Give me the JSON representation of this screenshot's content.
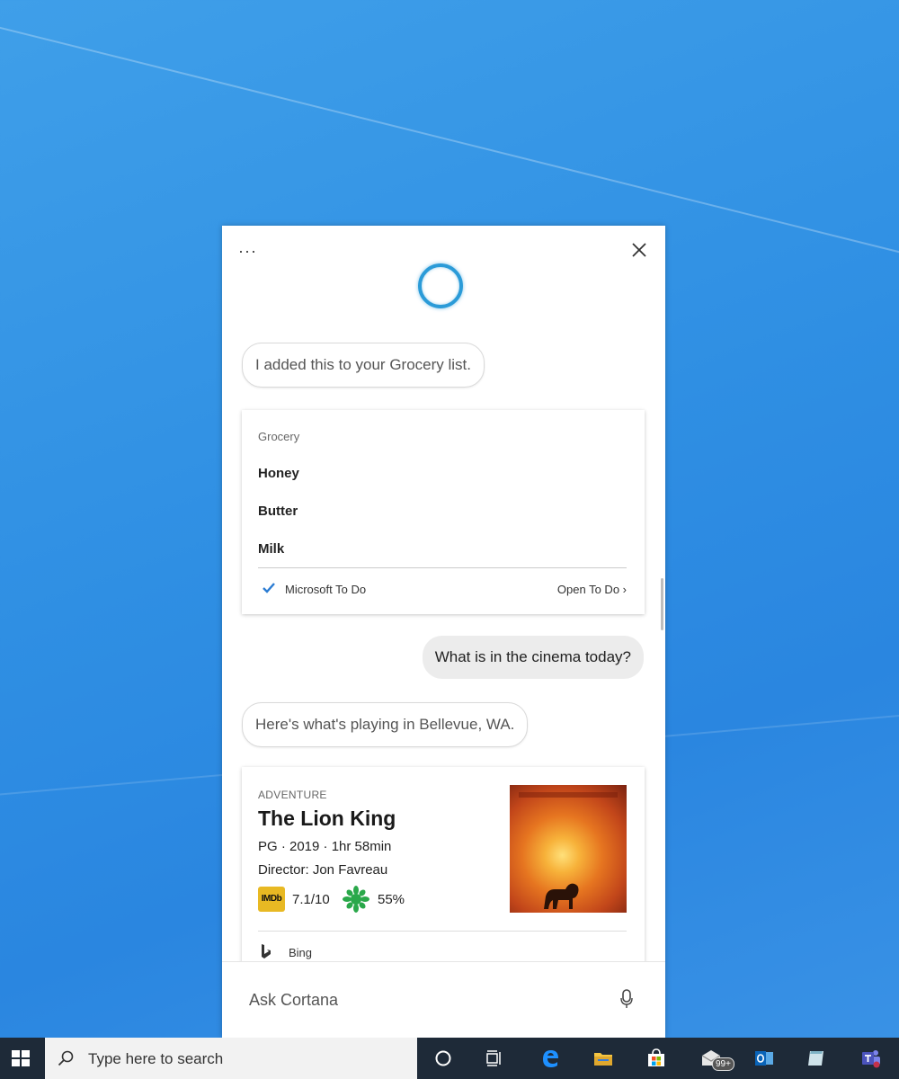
{
  "cortana": {
    "more_label": "···",
    "messages": {
      "grocery_added": "I added this to your Grocery list.",
      "user_query": "What is in the cinema today?",
      "playing_reply": "Here's what's playing in Bellevue, WA."
    },
    "grocery_card": {
      "title": "Grocery",
      "items": [
        "Honey",
        "Butter",
        "Milk"
      ],
      "source": "Microsoft To Do",
      "open_link": "Open To Do ›"
    },
    "movie_card": {
      "genre": "ADVENTURE",
      "title": "The Lion King",
      "meta": "PG · 2019 · 1hr 58min",
      "director": "Director: Jon Favreau",
      "imdb_label": "IMDb",
      "imdb_score": "7.1/10",
      "rt_score": "55%",
      "source": "Bing"
    },
    "ask_placeholder": "Ask Cortana"
  },
  "taskbar": {
    "search_placeholder": "Type here to search",
    "mail_badge": "99+",
    "icons": [
      "cortana-circle-icon",
      "task-view-icon",
      "edge-icon",
      "file-explorer-icon",
      "store-icon",
      "mail-icon",
      "outlook-icon",
      "notes-icon",
      "teams-icon"
    ]
  },
  "colors": {
    "cortana_ring": "#2b9bd8",
    "taskbar": "#1e2a38",
    "todo_check": "#2b7cd3",
    "desktop": "#2f8fe3"
  }
}
